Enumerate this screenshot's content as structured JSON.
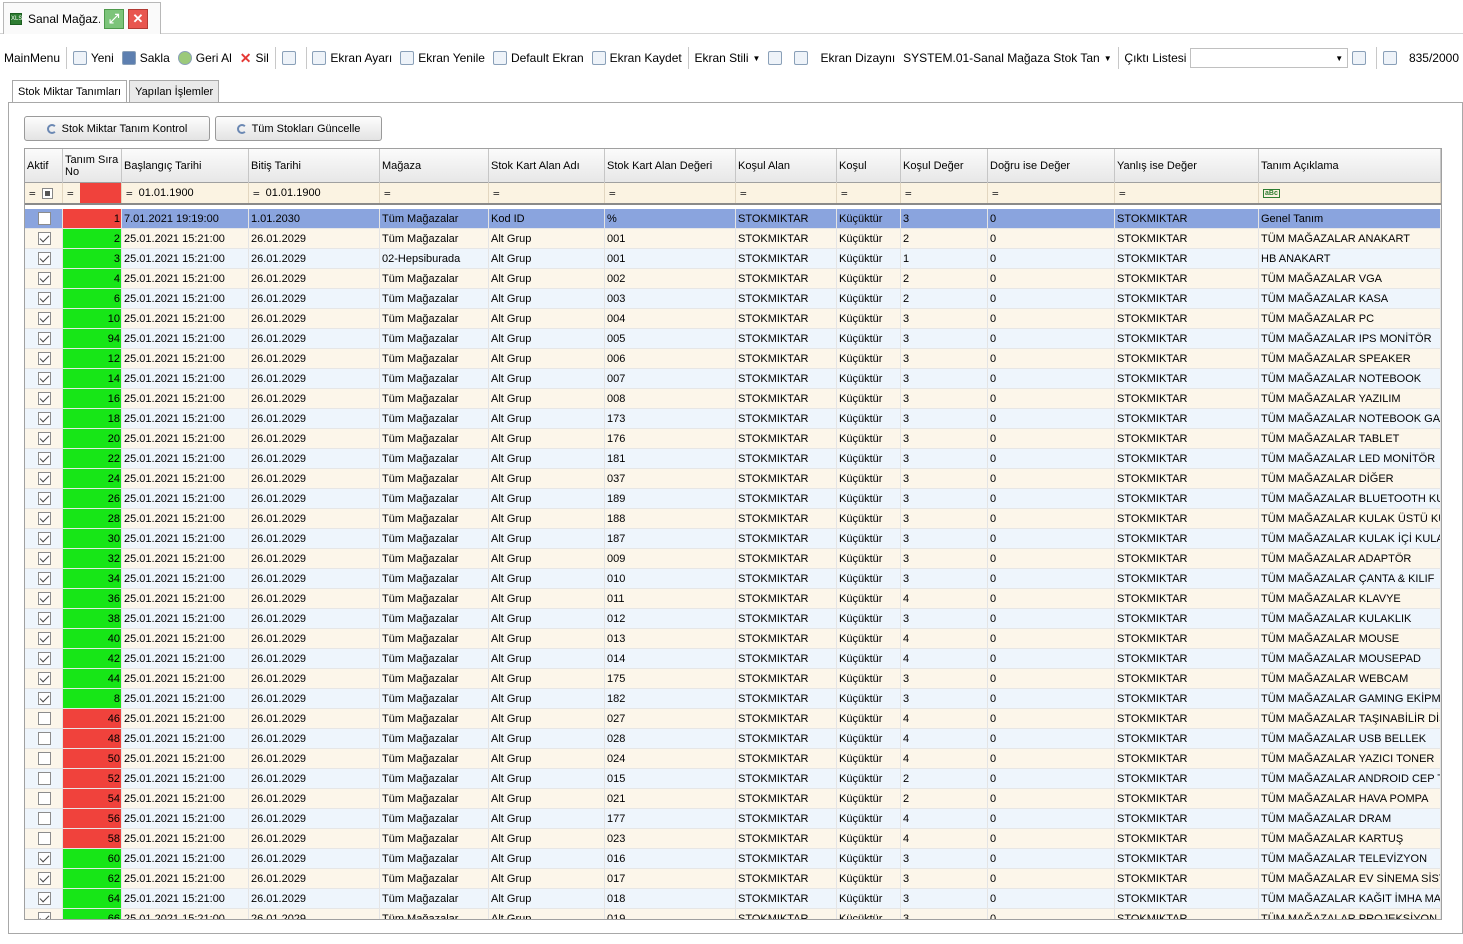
{
  "window": {
    "title": "Sanal Mağaz...",
    "app_icon": "XLS"
  },
  "toolbar": {
    "main_menu": "MainMenu",
    "new": "Yeni",
    "save": "Sakla",
    "undo": "Geri Al",
    "delete": "Sil",
    "screen_settings": "Ekran Ayarı",
    "screen_refresh": "Ekran Yenile",
    "default_screen": "Default Ekran",
    "save_screen": "Ekran Kaydet",
    "screen_style": "Ekran Stili",
    "screen_layout": "Ekran Dizaynı",
    "layout_value": "SYSTEM.01-Sanal Mağaza Stok Tan",
    "output_list": "Çıktı Listesi",
    "output_value": "",
    "record_count": "835/2000"
  },
  "tabs": [
    {
      "label": "Stok Miktar Tanımları",
      "active": true
    },
    {
      "label": "Yapılan İşlemler",
      "active": false
    }
  ],
  "buttons": {
    "check": "Stok Miktar Tanım Kontrol",
    "update": "Tüm Stokları Güncelle"
  },
  "grid": {
    "columns": [
      "Aktif",
      "Tanım Sıra No",
      "Başlangıç Tarihi",
      "Bitiş Tarihi",
      "Mağaza",
      "Stok Kart Alan Adı",
      "Stok Kart Alan Değeri",
      "Koşul Alan",
      "Koşul",
      "Koşul Değer",
      "Doğru ise Değer",
      "Yanlış ise Değer",
      "Tanım Açıklama"
    ],
    "filter": {
      "start_date": "01.01.1900",
      "end_date": "01.01.1900",
      "desc_icon": "abc-icon"
    },
    "rows": [
      {
        "active": false,
        "no": "1",
        "start": "7.01.2021 19:19:00",
        "end": "1.01.2030",
        "store": "Tüm Mağazalar",
        "field": "Kod ID",
        "value": "%",
        "cond_field": "STOKMIKTAR",
        "cond": "Küçüktür",
        "cond_val": "3",
        "true_val": "0",
        "false_val": "STOKMIKTAR",
        "desc": "Genel Tanım"
      },
      {
        "active": true,
        "no": "2",
        "start": "25.01.2021 15:21:00",
        "end": "26.01.2029",
        "store": "Tüm Mağazalar",
        "field": "Alt Grup",
        "value": "001",
        "cond_field": "STOKMIKTAR",
        "cond": "Küçüktür",
        "cond_val": "2",
        "true_val": "0",
        "false_val": "STOKMIKTAR",
        "desc": "TÜM MAĞAZALAR ANAKART"
      },
      {
        "active": true,
        "no": "3",
        "start": "25.01.2021 15:21:00",
        "end": "26.01.2029",
        "store": "02-Hepsiburada",
        "field": "Alt Grup",
        "value": "001",
        "cond_field": "STOKMIKTAR",
        "cond": "Küçüktür",
        "cond_val": "1",
        "true_val": "0",
        "false_val": "STOKMIKTAR",
        "desc": "HB ANAKART"
      },
      {
        "active": true,
        "no": "4",
        "start": "25.01.2021 15:21:00",
        "end": "26.01.2029",
        "store": "Tüm Mağazalar",
        "field": "Alt Grup",
        "value": "002",
        "cond_field": "STOKMIKTAR",
        "cond": "Küçüktür",
        "cond_val": "2",
        "true_val": "0",
        "false_val": "STOKMIKTAR",
        "desc": "TÜM MAĞAZALAR VGA"
      },
      {
        "active": true,
        "no": "6",
        "start": "25.01.2021 15:21:00",
        "end": "26.01.2029",
        "store": "Tüm Mağazalar",
        "field": "Alt Grup",
        "value": "003",
        "cond_field": "STOKMIKTAR",
        "cond": "Küçüktür",
        "cond_val": "2",
        "true_val": "0",
        "false_val": "STOKMIKTAR",
        "desc": "TÜM MAĞAZALAR KASA"
      },
      {
        "active": true,
        "no": "10",
        "start": "25.01.2021 15:21:00",
        "end": "26.01.2029",
        "store": "Tüm Mağazalar",
        "field": "Alt Grup",
        "value": "004",
        "cond_field": "STOKMIKTAR",
        "cond": "Küçüktür",
        "cond_val": "3",
        "true_val": "0",
        "false_val": "STOKMIKTAR",
        "desc": "TÜM MAĞAZALAR PC"
      },
      {
        "active": true,
        "no": "94",
        "start": "25.01.2021 15:21:00",
        "end": "26.01.2029",
        "store": "Tüm Mağazalar",
        "field": "Alt Grup",
        "value": "005",
        "cond_field": "STOKMIKTAR",
        "cond": "Küçüktür",
        "cond_val": "3",
        "true_val": "0",
        "false_val": "STOKMIKTAR",
        "desc": "TÜM MAĞAZALAR IPS MONİTÖR"
      },
      {
        "active": true,
        "no": "12",
        "start": "25.01.2021 15:21:00",
        "end": "26.01.2029",
        "store": "Tüm Mağazalar",
        "field": "Alt Grup",
        "value": "006",
        "cond_field": "STOKMIKTAR",
        "cond": "Küçüktür",
        "cond_val": "3",
        "true_val": "0",
        "false_val": "STOKMIKTAR",
        "desc": "TÜM MAĞAZALAR SPEAKER"
      },
      {
        "active": true,
        "no": "14",
        "start": "25.01.2021 15:21:00",
        "end": "26.01.2029",
        "store": "Tüm Mağazalar",
        "field": "Alt Grup",
        "value": "007",
        "cond_field": "STOKMIKTAR",
        "cond": "Küçüktür",
        "cond_val": "3",
        "true_val": "0",
        "false_val": "STOKMIKTAR",
        "desc": "TÜM MAĞAZALAR NOTEBOOK"
      },
      {
        "active": true,
        "no": "16",
        "start": "25.01.2021 15:21:00",
        "end": "26.01.2029",
        "store": "Tüm Mağazalar",
        "field": "Alt Grup",
        "value": "008",
        "cond_field": "STOKMIKTAR",
        "cond": "Küçüktür",
        "cond_val": "3",
        "true_val": "0",
        "false_val": "STOKMIKTAR",
        "desc": "TÜM MAĞAZALAR YAZILIM"
      },
      {
        "active": true,
        "no": "18",
        "start": "25.01.2021 15:21:00",
        "end": "26.01.2029",
        "store": "Tüm Mağazalar",
        "field": "Alt Grup",
        "value": "173",
        "cond_field": "STOKMIKTAR",
        "cond": "Küçüktür",
        "cond_val": "3",
        "true_val": "0",
        "false_val": "STOKMIKTAR",
        "desc": "TÜM MAĞAZALAR NOTEBOOK GAMING"
      },
      {
        "active": true,
        "no": "20",
        "start": "25.01.2021 15:21:00",
        "end": "26.01.2029",
        "store": "Tüm Mağazalar",
        "field": "Alt Grup",
        "value": "176",
        "cond_field": "STOKMIKTAR",
        "cond": "Küçüktür",
        "cond_val": "3",
        "true_val": "0",
        "false_val": "STOKMIKTAR",
        "desc": "TÜM MAĞAZALAR TABLET"
      },
      {
        "active": true,
        "no": "22",
        "start": "25.01.2021 15:21:00",
        "end": "26.01.2029",
        "store": "Tüm Mağazalar",
        "field": "Alt Grup",
        "value": "181",
        "cond_field": "STOKMIKTAR",
        "cond": "Küçüktür",
        "cond_val": "3",
        "true_val": "0",
        "false_val": "STOKMIKTAR",
        "desc": "TÜM MAĞAZALAR LED MONİTÖR"
      },
      {
        "active": true,
        "no": "24",
        "start": "25.01.2021 15:21:00",
        "end": "26.01.2029",
        "store": "Tüm Mağazalar",
        "field": "Alt Grup",
        "value": "037",
        "cond_field": "STOKMIKTAR",
        "cond": "Küçüktür",
        "cond_val": "3",
        "true_val": "0",
        "false_val": "STOKMIKTAR",
        "desc": "TÜM MAĞAZALAR DİĞER"
      },
      {
        "active": true,
        "no": "26",
        "start": "25.01.2021 15:21:00",
        "end": "26.01.2029",
        "store": "Tüm Mağazalar",
        "field": "Alt Grup",
        "value": "189",
        "cond_field": "STOKMIKTAR",
        "cond": "Küçüktür",
        "cond_val": "3",
        "true_val": "0",
        "false_val": "STOKMIKTAR",
        "desc": "TÜM MAĞAZALAR BLUETOOTH KULAKL"
      },
      {
        "active": true,
        "no": "28",
        "start": "25.01.2021 15:21:00",
        "end": "26.01.2029",
        "store": "Tüm Mağazalar",
        "field": "Alt Grup",
        "value": "188",
        "cond_field": "STOKMIKTAR",
        "cond": "Küçüktür",
        "cond_val": "3",
        "true_val": "0",
        "false_val": "STOKMIKTAR",
        "desc": "TÜM MAĞAZALAR KULAK ÜSTÜ KULAKL"
      },
      {
        "active": true,
        "no": "30",
        "start": "25.01.2021 15:21:00",
        "end": "26.01.2029",
        "store": "Tüm Mağazalar",
        "field": "Alt Grup",
        "value": "187",
        "cond_field": "STOKMIKTAR",
        "cond": "Küçüktür",
        "cond_val": "3",
        "true_val": "0",
        "false_val": "STOKMIKTAR",
        "desc": "TÜM MAĞAZALAR KULAK İÇİ KULAKLIK"
      },
      {
        "active": true,
        "no": "32",
        "start": "25.01.2021 15:21:00",
        "end": "26.01.2029",
        "store": "Tüm Mağazalar",
        "field": "Alt Grup",
        "value": "009",
        "cond_field": "STOKMIKTAR",
        "cond": "Küçüktür",
        "cond_val": "3",
        "true_val": "0",
        "false_val": "STOKMIKTAR",
        "desc": "TÜM MAĞAZALAR ADAPTÖR"
      },
      {
        "active": true,
        "no": "34",
        "start": "25.01.2021 15:21:00",
        "end": "26.01.2029",
        "store": "Tüm Mağazalar",
        "field": "Alt Grup",
        "value": "010",
        "cond_field": "STOKMIKTAR",
        "cond": "Küçüktür",
        "cond_val": "3",
        "true_val": "0",
        "false_val": "STOKMIKTAR",
        "desc": "TÜM MAĞAZALAR ÇANTA & KILIF"
      },
      {
        "active": true,
        "no": "36",
        "start": "25.01.2021 15:21:00",
        "end": "26.01.2029",
        "store": "Tüm Mağazalar",
        "field": "Alt Grup",
        "value": "011",
        "cond_field": "STOKMIKTAR",
        "cond": "Küçüktür",
        "cond_val": "4",
        "true_val": "0",
        "false_val": "STOKMIKTAR",
        "desc": "TÜM MAĞAZALAR KLAVYE"
      },
      {
        "active": true,
        "no": "38",
        "start": "25.01.2021 15:21:00",
        "end": "26.01.2029",
        "store": "Tüm Mağazalar",
        "field": "Alt Grup",
        "value": "012",
        "cond_field": "STOKMIKTAR",
        "cond": "Küçüktür",
        "cond_val": "3",
        "true_val": "0",
        "false_val": "STOKMIKTAR",
        "desc": "TÜM MAĞAZALAR KULAKLIK"
      },
      {
        "active": true,
        "no": "40",
        "start": "25.01.2021 15:21:00",
        "end": "26.01.2029",
        "store": "Tüm Mağazalar",
        "field": "Alt Grup",
        "value": "013",
        "cond_field": "STOKMIKTAR",
        "cond": "Küçüktür",
        "cond_val": "4",
        "true_val": "0",
        "false_val": "STOKMIKTAR",
        "desc": "TÜM MAĞAZALAR MOUSE"
      },
      {
        "active": true,
        "no": "42",
        "start": "25.01.2021 15:21:00",
        "end": "26.01.2029",
        "store": "Tüm Mağazalar",
        "field": "Alt Grup",
        "value": "014",
        "cond_field": "STOKMIKTAR",
        "cond": "Küçüktür",
        "cond_val": "4",
        "true_val": "0",
        "false_val": "STOKMIKTAR",
        "desc": "TÜM MAĞAZALAR MOUSEPAD"
      },
      {
        "active": true,
        "no": "44",
        "start": "25.01.2021 15:21:00",
        "end": "26.01.2029",
        "store": "Tüm Mağazalar",
        "field": "Alt Grup",
        "value": "175",
        "cond_field": "STOKMIKTAR",
        "cond": "Küçüktür",
        "cond_val": "3",
        "true_val": "0",
        "false_val": "STOKMIKTAR",
        "desc": "TÜM MAĞAZALAR WEBCAM"
      },
      {
        "active": true,
        "no": "8",
        "start": "25.01.2021 15:21:00",
        "end": "26.01.2029",
        "store": "Tüm Mağazalar",
        "field": "Alt Grup",
        "value": "182",
        "cond_field": "STOKMIKTAR",
        "cond": "Küçüktür",
        "cond_val": "3",
        "true_val": "0",
        "false_val": "STOKMIKTAR",
        "desc": "TÜM MAĞAZALAR GAMING EKİPMAN"
      },
      {
        "active": false,
        "no": "46",
        "start": "25.01.2021 15:21:00",
        "end": "26.01.2029",
        "store": "Tüm Mağazalar",
        "field": "Alt Grup",
        "value": "027",
        "cond_field": "STOKMIKTAR",
        "cond": "Küçüktür",
        "cond_val": "4",
        "true_val": "0",
        "false_val": "STOKMIKTAR",
        "desc": "TÜM MAĞAZALAR TAŞINABİLİR DİSK"
      },
      {
        "active": false,
        "no": "48",
        "start": "25.01.2021 15:21:00",
        "end": "26.01.2029",
        "store": "Tüm Mağazalar",
        "field": "Alt Grup",
        "value": "028",
        "cond_field": "STOKMIKTAR",
        "cond": "Küçüktür",
        "cond_val": "4",
        "true_val": "0",
        "false_val": "STOKMIKTAR",
        "desc": "TÜM MAĞAZALAR USB BELLEK"
      },
      {
        "active": false,
        "no": "50",
        "start": "25.01.2021 15:21:00",
        "end": "26.01.2029",
        "store": "Tüm Mağazalar",
        "field": "Alt Grup",
        "value": "024",
        "cond_field": "STOKMIKTAR",
        "cond": "Küçüktür",
        "cond_val": "4",
        "true_val": "0",
        "false_val": "STOKMIKTAR",
        "desc": "TÜM MAĞAZALAR YAZICI TONER"
      },
      {
        "active": false,
        "no": "52",
        "start": "25.01.2021 15:21:00",
        "end": "26.01.2029",
        "store": "Tüm Mağazalar",
        "field": "Alt Grup",
        "value": "015",
        "cond_field": "STOKMIKTAR",
        "cond": "Küçüktür",
        "cond_val": "2",
        "true_val": "0",
        "false_val": "STOKMIKTAR",
        "desc": "TÜM MAĞAZALAR ANDROID CEP TELEF"
      },
      {
        "active": false,
        "no": "54",
        "start": "25.01.2021 15:21:00",
        "end": "26.01.2029",
        "store": "Tüm Mağazalar",
        "field": "Alt Grup",
        "value": "021",
        "cond_field": "STOKMIKTAR",
        "cond": "Küçüktür",
        "cond_val": "2",
        "true_val": "0",
        "false_val": "STOKMIKTAR",
        "desc": "TÜM MAĞAZALAR HAVA POMPA"
      },
      {
        "active": false,
        "no": "56",
        "start": "25.01.2021 15:21:00",
        "end": "26.01.2029",
        "store": "Tüm Mağazalar",
        "field": "Alt Grup",
        "value": "177",
        "cond_field": "STOKMIKTAR",
        "cond": "Küçüktür",
        "cond_val": "4",
        "true_val": "0",
        "false_val": "STOKMIKTAR",
        "desc": "TÜM MAĞAZALAR DRAM"
      },
      {
        "active": false,
        "no": "58",
        "start": "25.01.2021 15:21:00",
        "end": "26.01.2029",
        "store": "Tüm Mağazalar",
        "field": "Alt Grup",
        "value": "023",
        "cond_field": "STOKMIKTAR",
        "cond": "Küçüktür",
        "cond_val": "4",
        "true_val": "0",
        "false_val": "STOKMIKTAR",
        "desc": "TÜM MAĞAZALAR KARTUŞ"
      },
      {
        "active": true,
        "no": "60",
        "start": "25.01.2021 15:21:00",
        "end": "26.01.2029",
        "store": "Tüm Mağazalar",
        "field": "Alt Grup",
        "value": "016",
        "cond_field": "STOKMIKTAR",
        "cond": "Küçüktür",
        "cond_val": "3",
        "true_val": "0",
        "false_val": "STOKMIKTAR",
        "desc": "TÜM MAĞAZALAR TELEVİZYON"
      },
      {
        "active": true,
        "no": "62",
        "start": "25.01.2021 15:21:00",
        "end": "26.01.2029",
        "store": "Tüm Mağazalar",
        "field": "Alt Grup",
        "value": "017",
        "cond_field": "STOKMIKTAR",
        "cond": "Küçüktür",
        "cond_val": "3",
        "true_val": "0",
        "false_val": "STOKMIKTAR",
        "desc": "TÜM MAĞAZALAR EV SİNEMA SİSTEM"
      },
      {
        "active": true,
        "no": "64",
        "start": "25.01.2021 15:21:00",
        "end": "26.01.2029",
        "store": "Tüm Mağazalar",
        "field": "Alt Grup",
        "value": "018",
        "cond_field": "STOKMIKTAR",
        "cond": "Küçüktür",
        "cond_val": "3",
        "true_val": "0",
        "false_val": "STOKMIKTAR",
        "desc": "TÜM MAĞAZALAR KAĞIT İMHA MAKİNE"
      },
      {
        "active": true,
        "no": "66",
        "start": "25.01.2021 15:21:00",
        "end": "26.01.2029",
        "store": "Tüm Mağazalar",
        "field": "Alt Grup",
        "value": "019",
        "cond_field": "STOKMIKTAR",
        "cond": "Küçüktür",
        "cond_val": "3",
        "true_val": "0",
        "false_val": "STOKMIKTAR",
        "desc": "TÜM MAĞAZALAR PROJEKSİYON CİHA"
      }
    ]
  },
  "colors": {
    "active_no": "#17e617",
    "inactive_no": "#f0423c",
    "selected_row": "#8aa4de"
  }
}
